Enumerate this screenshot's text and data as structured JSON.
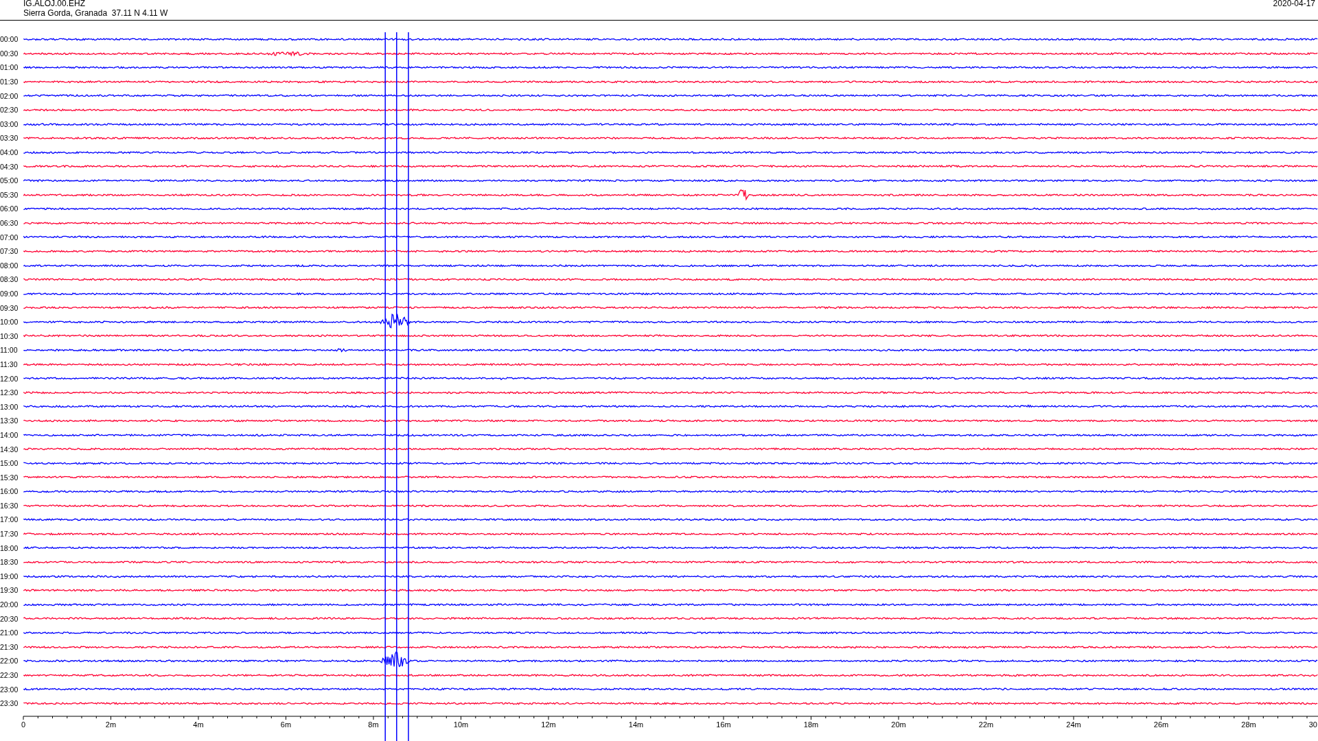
{
  "header": {
    "station": "IG.ALOJ.00.EHZ",
    "location": "Sierra Gorda, Granada  37.11 N 4.11 W",
    "date": "2020-04-17"
  },
  "rows": [
    {
      "time": "00:00",
      "color": "#0000ff"
    },
    {
      "time": "00:30",
      "color": "#ff0033"
    },
    {
      "time": "01:00",
      "color": "#0000ff"
    },
    {
      "time": "01:30",
      "color": "#ff0033"
    },
    {
      "time": "02:00",
      "color": "#0000ff"
    },
    {
      "time": "02:30",
      "color": "#ff0033"
    },
    {
      "time": "03:00",
      "color": "#0000ff"
    },
    {
      "time": "03:30",
      "color": "#ff0033"
    },
    {
      "time": "04:00",
      "color": "#0000ff"
    },
    {
      "time": "04:30",
      "color": "#ff0033"
    },
    {
      "time": "05:00",
      "color": "#0000ff"
    },
    {
      "time": "05:30",
      "color": "#ff0033"
    },
    {
      "time": "06:00",
      "color": "#0000ff"
    },
    {
      "time": "06:30",
      "color": "#ff0033"
    },
    {
      "time": "07:00",
      "color": "#0000ff"
    },
    {
      "time": "07:30",
      "color": "#ff0033"
    },
    {
      "time": "08:00",
      "color": "#0000ff"
    },
    {
      "time": "08:30",
      "color": "#ff0033"
    },
    {
      "time": "09:00",
      "color": "#0000ff"
    },
    {
      "time": "09:30",
      "color": "#ff0033"
    },
    {
      "time": "10:00",
      "color": "#0000ff"
    },
    {
      "time": "10:30",
      "color": "#ff0033"
    },
    {
      "time": "11:00",
      "color": "#0000ff"
    },
    {
      "time": "11:30",
      "color": "#ff0033"
    },
    {
      "time": "12:00",
      "color": "#0000ff"
    },
    {
      "time": "12:30",
      "color": "#ff0033"
    },
    {
      "time": "13:00",
      "color": "#0000ff"
    },
    {
      "time": "13:30",
      "color": "#ff0033"
    },
    {
      "time": "14:00",
      "color": "#0000ff"
    },
    {
      "time": "14:30",
      "color": "#ff0033"
    },
    {
      "time": "15:00",
      "color": "#0000ff"
    },
    {
      "time": "15:30",
      "color": "#ff0033"
    },
    {
      "time": "16:00",
      "color": "#0000ff"
    },
    {
      "time": "16:30",
      "color": "#ff0033"
    },
    {
      "time": "17:00",
      "color": "#0000ff"
    },
    {
      "time": "17:30",
      "color": "#ff0033"
    },
    {
      "time": "18:00",
      "color": "#0000ff"
    },
    {
      "time": "18:30",
      "color": "#ff0033"
    },
    {
      "time": "19:00",
      "color": "#0000ff"
    },
    {
      "time": "19:30",
      "color": "#ff0033"
    },
    {
      "time": "20:00",
      "color": "#0000ff"
    },
    {
      "time": "20:30",
      "color": "#ff0033"
    },
    {
      "time": "21:00",
      "color": "#0000ff"
    },
    {
      "time": "21:30",
      "color": "#ff0033"
    },
    {
      "time": "22:00",
      "color": "#0000ff"
    },
    {
      "time": "22:30",
      "color": "#ff0033"
    },
    {
      "time": "23:00",
      "color": "#0000ff"
    },
    {
      "time": "23:30",
      "color": "#ff0033"
    }
  ],
  "x_axis": {
    "tick_labels": [
      "0",
      "2m",
      "4m",
      "6m",
      "8m",
      "10m",
      "12m",
      "14m",
      "16m",
      "18m",
      "20m",
      "22m",
      "24m",
      "26m",
      "28m",
      "30"
    ]
  }
}
